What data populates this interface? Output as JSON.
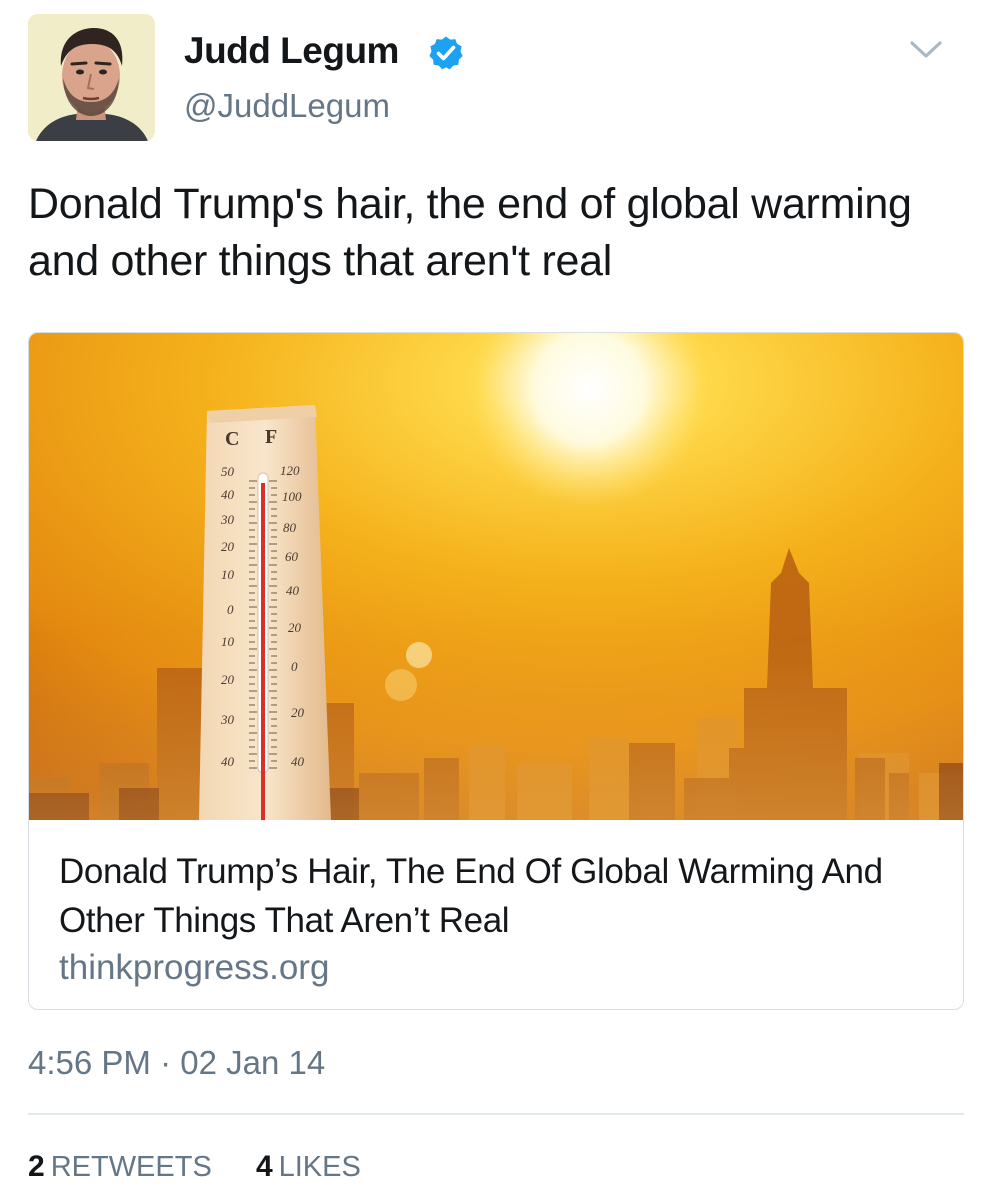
{
  "tweet": {
    "display_name": "Judd Legum",
    "handle": "@JuddLegum",
    "text": "Donald Trump's hair, the end of global warming and other things that aren't real",
    "timestamp": "4:56 PM · 02 Jan 14"
  },
  "card": {
    "title": "Donald Trump’s Hair, The End Of Global Warming And Other Things That Aren’t Real",
    "domain": "thinkprogress.org",
    "thermometer": {
      "unit_c": "C",
      "unit_f": "F",
      "celsius_ticks": [
        "50",
        "40",
        "30",
        "20",
        "10",
        "0",
        "10",
        "20",
        "30",
        "40"
      ],
      "fahrenheit_ticks": [
        "120",
        "100",
        "80",
        "60",
        "40",
        "20",
        "0",
        "20",
        "40"
      ]
    }
  },
  "stats": {
    "retweets_count": "2",
    "retweets_label": "RETWEETS",
    "likes_count": "4",
    "likes_label": "LIKES"
  },
  "colors": {
    "verified": "#1da1f2",
    "secondary_text": "#657786",
    "primary_text": "#14171a"
  },
  "icons": {
    "verified": "verified-badge-icon",
    "menu": "chevron-down-icon"
  }
}
